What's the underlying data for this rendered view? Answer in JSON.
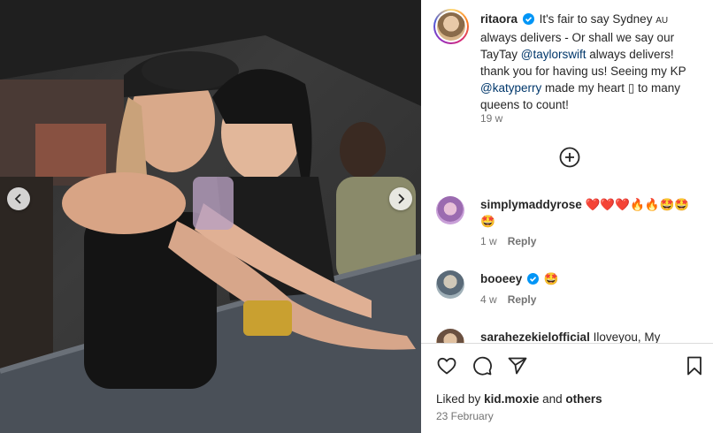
{
  "post": {
    "username": "ritaora",
    "caption_parts": {
      "p1": "It's fair to say Sydney",
      "flag": "AU",
      "p2": "always delivers - Or shall we say our TayTay",
      "mention1": "@taylorswift",
      "p3": "always delivers! thank you for having us! Seeing my KP",
      "mention2": "@katyperry",
      "p4": "made my heart",
      "heart_glyph": "▯",
      "p5": "to many queens to count!"
    },
    "caption_time": "19 w",
    "likes_prefix": "Liked by",
    "likes_user": "kid.moxie",
    "likes_and": "and",
    "likes_others": "others",
    "date": "23 February"
  },
  "comments": [
    {
      "username": "simplymaddyrose",
      "text": "❤️❤️❤️🔥🔥🤩🤩🤩",
      "time": "1 w",
      "reply_label": "Reply"
    },
    {
      "username": "booeey",
      "text": "🤩",
      "time": "4 w",
      "reply_label": "Reply"
    },
    {
      "username": "sarahezekielofficial",
      "text": "Iloveyou, My"
    }
  ],
  "icons": {
    "load_more": "plus-circle-icon",
    "like": "heart-outline-icon",
    "comment": "comment-bubble-icon",
    "share": "paper-plane-icon",
    "save": "bookmark-icon",
    "prev": "chevron-left-icon",
    "next": "chevron-right-icon",
    "verified": "verified-badge-icon"
  },
  "colors": {
    "verified_blue": "#0095f6",
    "mention": "#00376b",
    "secondary_text": "#737373"
  }
}
